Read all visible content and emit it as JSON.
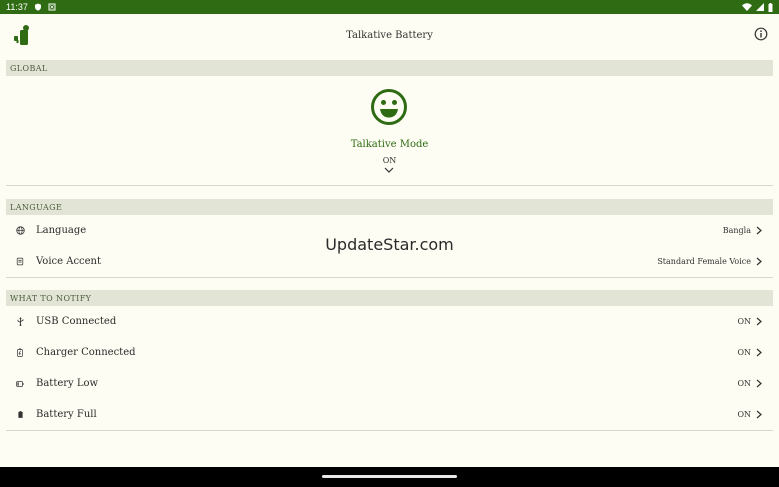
{
  "status_bar": {
    "time": "11:37"
  },
  "app_bar": {
    "title": "Talkative Battery"
  },
  "global": {
    "header": "GLOBAL",
    "mode_label": "Talkative Mode",
    "mode_value": "ON",
    "mode_icon": "smiley-face-icon"
  },
  "language": {
    "header": "LANGUAGE",
    "items": [
      {
        "label": "Language",
        "value": "Bangla",
        "icon": "globe-icon"
      },
      {
        "label": "Voice Accent",
        "value": "Standard Female Voice",
        "icon": "voice-accent-icon"
      }
    ]
  },
  "notify": {
    "header": "WHAT TO NOTIFY",
    "items": [
      {
        "label": "USB Connected",
        "value": "ON",
        "icon": "usb-icon"
      },
      {
        "label": "Charger Connected",
        "value": "ON",
        "icon": "charger-icon"
      },
      {
        "label": "Battery Low",
        "value": "ON",
        "icon": "battery-low-icon"
      },
      {
        "label": "Battery Full",
        "value": "ON",
        "icon": "battery-full-icon"
      }
    ]
  },
  "watermark": "UpdateStar.com",
  "colors": {
    "accent": "#2e6b12",
    "background": "#fdfdf3",
    "section_bg": "#e2e5d6"
  }
}
